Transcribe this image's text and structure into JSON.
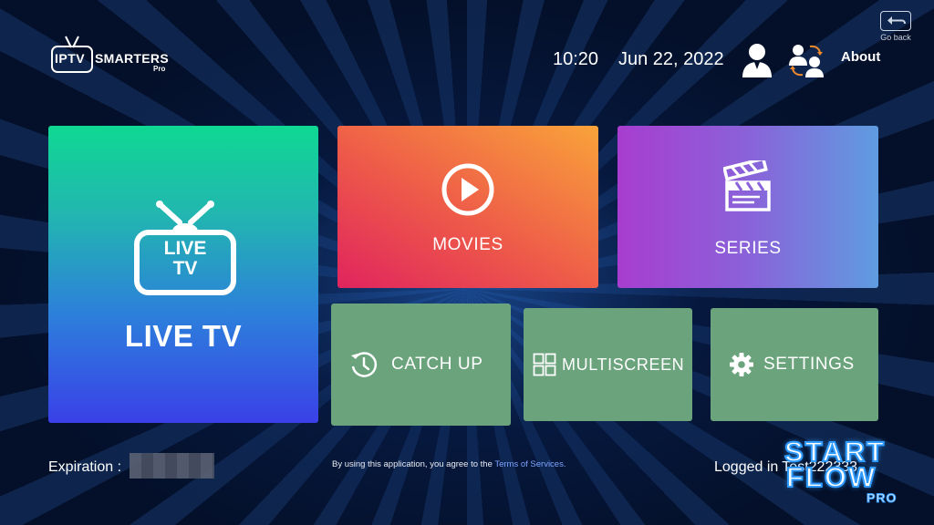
{
  "header": {
    "logo": {
      "brand": "IPTV",
      "name": "SMARTERS",
      "edition": "Pro"
    },
    "time": "10:20",
    "date": "Jun 22, 2022",
    "profile_icon": "user-icon",
    "switch_user_icon": "switch-user-icon",
    "about_label": "About",
    "go_back_label": "Go back"
  },
  "tiles": {
    "live_tv": {
      "icon_line1": "LIVE",
      "icon_line2": "TV",
      "label": "LIVE TV",
      "icon": "tv-icon"
    },
    "movies": {
      "label": "MOVIES",
      "icon": "play-icon"
    },
    "series": {
      "label": "SERIES",
      "icon": "clapperboard-icon"
    },
    "catch_up": {
      "label": "CATCH UP",
      "icon": "clock-icon"
    },
    "multiscreen": {
      "label": "MULTISCREEN",
      "icon": "grid-icon"
    },
    "settings": {
      "label": "SETTINGS",
      "icon": "gear-icon"
    }
  },
  "footer": {
    "expiration_label": "Expiration :",
    "terms_prefix": "By using this application, you agree to the",
    "terms_link": "Terms of Services.",
    "logged_in_label": "Logged in",
    "username": "Test222333"
  },
  "watermark": {
    "line1": "START",
    "line2": "FLOW",
    "line3": "PRO"
  },
  "colors": {
    "live_tv_gradient": [
      "#0fd893",
      "#3a40e8"
    ],
    "movies_gradient": [
      "#e0245e",
      "#f9a33a"
    ],
    "series_gradient": [
      "#a83dd0",
      "#5f9ce0"
    ],
    "small_tile": "#6aa37c",
    "link": "#7fa4ff"
  }
}
